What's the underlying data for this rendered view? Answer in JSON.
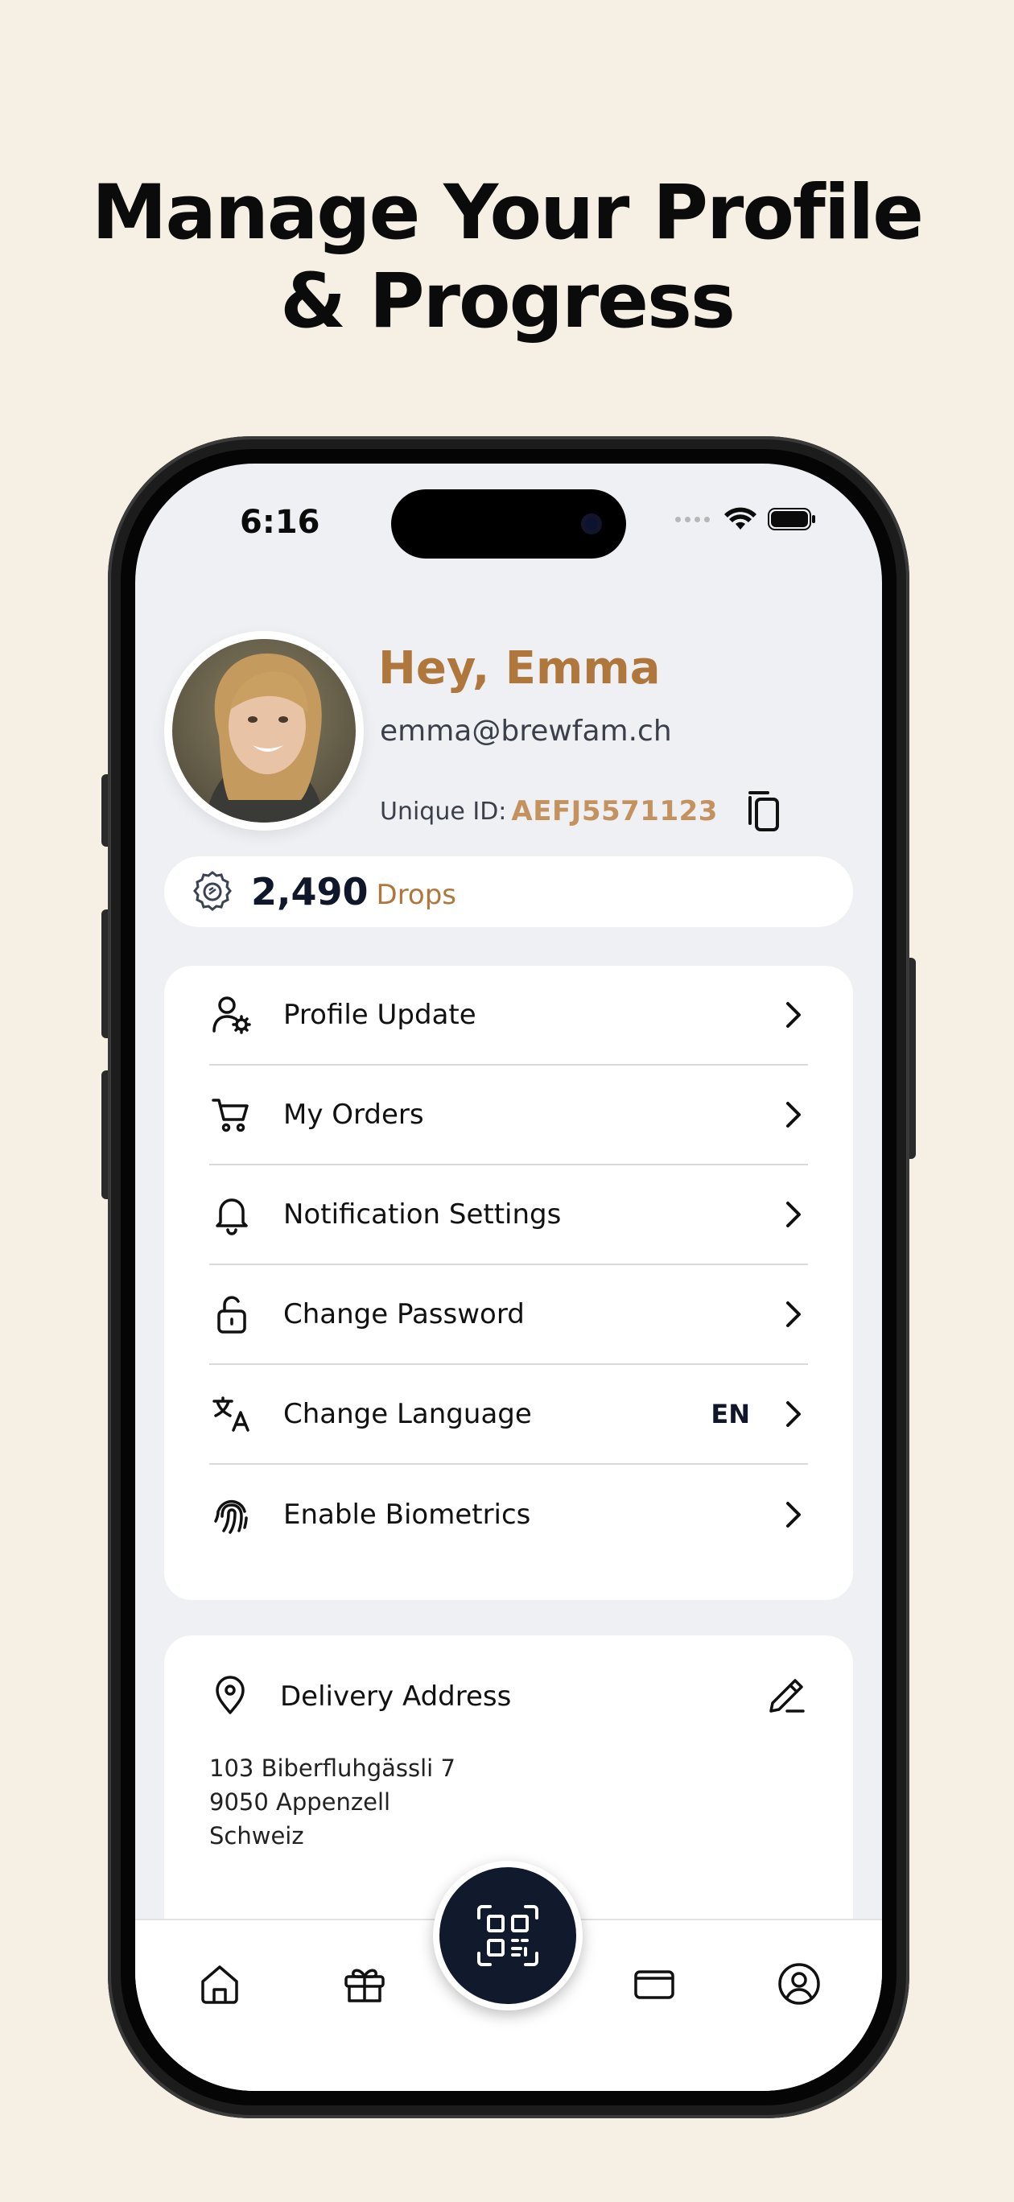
{
  "headline": {
    "line1": "Manage Your Profile",
    "line2": "& Progress"
  },
  "status_bar": {
    "time": "6:16"
  },
  "profile": {
    "greeting": "Hey, Emma",
    "email": "emma@brewfam.ch",
    "unique_id_label": "Unique ID:",
    "unique_id": "AEFJ5571123"
  },
  "drops": {
    "value": "2,490",
    "label": "Drops"
  },
  "menu": {
    "items": [
      {
        "label": "Profile Update",
        "icon": "user-gear-icon"
      },
      {
        "label": "My Orders",
        "icon": "cart-icon"
      },
      {
        "label": "Notification Settings",
        "icon": "bell-icon"
      },
      {
        "label": "Change Password",
        "icon": "unlock-icon"
      },
      {
        "label": "Change Language",
        "icon": "translate-icon",
        "value": "EN"
      },
      {
        "label": "Enable Biometrics",
        "icon": "fingerprint-icon"
      }
    ]
  },
  "address": {
    "title": "Delivery Address",
    "lines": [
      "103 Biberfluhgässli 7",
      "9050 Appenzell",
      "Schweiz"
    ]
  },
  "tabbar": {
    "tabs": [
      "home-icon",
      "gift-icon",
      "qr-scan-icon",
      "wallet-icon",
      "account-icon"
    ]
  },
  "colors": {
    "background": "#f5efe4",
    "accent": "#b0773c",
    "accent_light": "#c4925e",
    "navy": "#111a2c",
    "screen_bg": "#eff0f4"
  }
}
